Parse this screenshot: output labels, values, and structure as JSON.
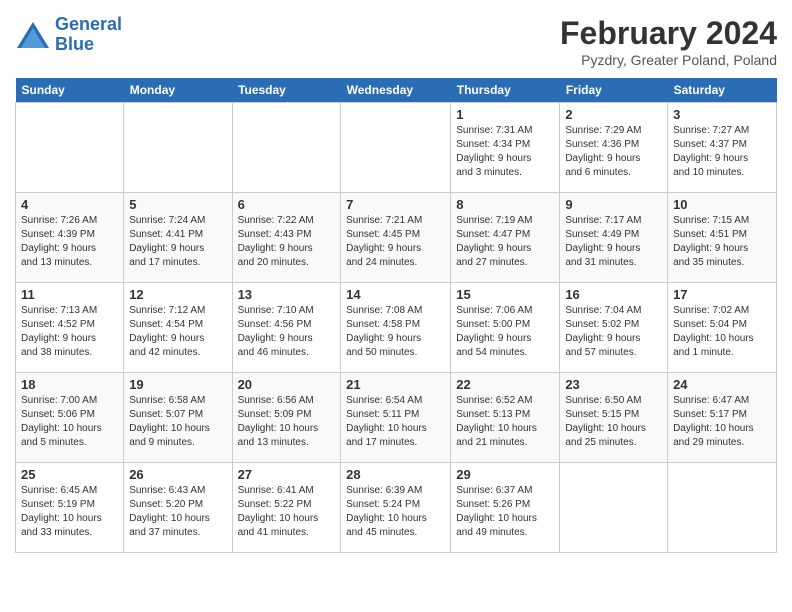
{
  "header": {
    "logo_line1": "General",
    "logo_line2": "Blue",
    "title": "February 2024",
    "subtitle": "Pyzdry, Greater Poland, Poland"
  },
  "weekdays": [
    "Sunday",
    "Monday",
    "Tuesday",
    "Wednesday",
    "Thursday",
    "Friday",
    "Saturday"
  ],
  "weeks": [
    [
      {
        "num": "",
        "info": ""
      },
      {
        "num": "",
        "info": ""
      },
      {
        "num": "",
        "info": ""
      },
      {
        "num": "",
        "info": ""
      },
      {
        "num": "1",
        "info": "Sunrise: 7:31 AM\nSunset: 4:34 PM\nDaylight: 9 hours\nand 3 minutes."
      },
      {
        "num": "2",
        "info": "Sunrise: 7:29 AM\nSunset: 4:36 PM\nDaylight: 9 hours\nand 6 minutes."
      },
      {
        "num": "3",
        "info": "Sunrise: 7:27 AM\nSunset: 4:37 PM\nDaylight: 9 hours\nand 10 minutes."
      }
    ],
    [
      {
        "num": "4",
        "info": "Sunrise: 7:26 AM\nSunset: 4:39 PM\nDaylight: 9 hours\nand 13 minutes."
      },
      {
        "num": "5",
        "info": "Sunrise: 7:24 AM\nSunset: 4:41 PM\nDaylight: 9 hours\nand 17 minutes."
      },
      {
        "num": "6",
        "info": "Sunrise: 7:22 AM\nSunset: 4:43 PM\nDaylight: 9 hours\nand 20 minutes."
      },
      {
        "num": "7",
        "info": "Sunrise: 7:21 AM\nSunset: 4:45 PM\nDaylight: 9 hours\nand 24 minutes."
      },
      {
        "num": "8",
        "info": "Sunrise: 7:19 AM\nSunset: 4:47 PM\nDaylight: 9 hours\nand 27 minutes."
      },
      {
        "num": "9",
        "info": "Sunrise: 7:17 AM\nSunset: 4:49 PM\nDaylight: 9 hours\nand 31 minutes."
      },
      {
        "num": "10",
        "info": "Sunrise: 7:15 AM\nSunset: 4:51 PM\nDaylight: 9 hours\nand 35 minutes."
      }
    ],
    [
      {
        "num": "11",
        "info": "Sunrise: 7:13 AM\nSunset: 4:52 PM\nDaylight: 9 hours\nand 38 minutes."
      },
      {
        "num": "12",
        "info": "Sunrise: 7:12 AM\nSunset: 4:54 PM\nDaylight: 9 hours\nand 42 minutes."
      },
      {
        "num": "13",
        "info": "Sunrise: 7:10 AM\nSunset: 4:56 PM\nDaylight: 9 hours\nand 46 minutes."
      },
      {
        "num": "14",
        "info": "Sunrise: 7:08 AM\nSunset: 4:58 PM\nDaylight: 9 hours\nand 50 minutes."
      },
      {
        "num": "15",
        "info": "Sunrise: 7:06 AM\nSunset: 5:00 PM\nDaylight: 9 hours\nand 54 minutes."
      },
      {
        "num": "16",
        "info": "Sunrise: 7:04 AM\nSunset: 5:02 PM\nDaylight: 9 hours\nand 57 minutes."
      },
      {
        "num": "17",
        "info": "Sunrise: 7:02 AM\nSunset: 5:04 PM\nDaylight: 10 hours\nand 1 minute."
      }
    ],
    [
      {
        "num": "18",
        "info": "Sunrise: 7:00 AM\nSunset: 5:06 PM\nDaylight: 10 hours\nand 5 minutes."
      },
      {
        "num": "19",
        "info": "Sunrise: 6:58 AM\nSunset: 5:07 PM\nDaylight: 10 hours\nand 9 minutes."
      },
      {
        "num": "20",
        "info": "Sunrise: 6:56 AM\nSunset: 5:09 PM\nDaylight: 10 hours\nand 13 minutes."
      },
      {
        "num": "21",
        "info": "Sunrise: 6:54 AM\nSunset: 5:11 PM\nDaylight: 10 hours\nand 17 minutes."
      },
      {
        "num": "22",
        "info": "Sunrise: 6:52 AM\nSunset: 5:13 PM\nDaylight: 10 hours\nand 21 minutes."
      },
      {
        "num": "23",
        "info": "Sunrise: 6:50 AM\nSunset: 5:15 PM\nDaylight: 10 hours\nand 25 minutes."
      },
      {
        "num": "24",
        "info": "Sunrise: 6:47 AM\nSunset: 5:17 PM\nDaylight: 10 hours\nand 29 minutes."
      }
    ],
    [
      {
        "num": "25",
        "info": "Sunrise: 6:45 AM\nSunset: 5:19 PM\nDaylight: 10 hours\nand 33 minutes."
      },
      {
        "num": "26",
        "info": "Sunrise: 6:43 AM\nSunset: 5:20 PM\nDaylight: 10 hours\nand 37 minutes."
      },
      {
        "num": "27",
        "info": "Sunrise: 6:41 AM\nSunset: 5:22 PM\nDaylight: 10 hours\nand 41 minutes."
      },
      {
        "num": "28",
        "info": "Sunrise: 6:39 AM\nSunset: 5:24 PM\nDaylight: 10 hours\nand 45 minutes."
      },
      {
        "num": "29",
        "info": "Sunrise: 6:37 AM\nSunset: 5:26 PM\nDaylight: 10 hours\nand 49 minutes."
      },
      {
        "num": "",
        "info": ""
      },
      {
        "num": "",
        "info": ""
      }
    ]
  ]
}
